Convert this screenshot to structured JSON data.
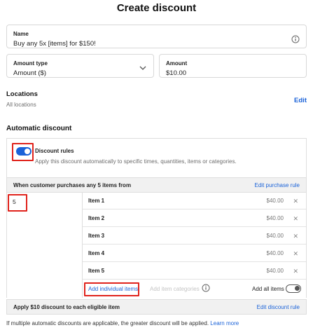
{
  "page": {
    "title": "Create discount"
  },
  "name_field": {
    "label": "Name",
    "value": "Buy any 5x [items] for $150!"
  },
  "amount_type_field": {
    "label": "Amount type",
    "value": "Amount ($)"
  },
  "amount_field": {
    "label": "Amount",
    "value": "$10.00"
  },
  "locations": {
    "title": "Locations",
    "subtitle": "All locations",
    "edit_label": "Edit"
  },
  "automatic_discount": {
    "title": "Automatic discount",
    "rules_title": "Discount rules",
    "rules_desc": "Apply this discount automatically to specific times, quantities, items or categories.",
    "rules_enabled": true
  },
  "purchase_rule": {
    "text": "When customer purchases any 5 items from",
    "edit_label": "Edit purchase rule",
    "quantity": "5"
  },
  "items": [
    {
      "name": "Item 1",
      "price": "$40.00"
    },
    {
      "name": "Item 2",
      "price": "$40.00"
    },
    {
      "name": "Item 3",
      "price": "$40.00"
    },
    {
      "name": "Item 4",
      "price": "$40.00"
    },
    {
      "name": "Item 5",
      "price": "$40.00"
    }
  ],
  "item_actions": {
    "add_individual": "Add individual items",
    "add_categories": "Add item categories",
    "add_all": "Add all items",
    "add_all_enabled": false
  },
  "discount_rule": {
    "text": "Apply $10 discount to each eligible item",
    "edit_label": "Edit discount rule"
  },
  "footnote": {
    "text": "If multiple automatic discounts are applicable, the greater discount will be applied.",
    "link": "Learn more"
  },
  "colors": {
    "accent": "#1a62d8",
    "highlight": "#e0231c"
  }
}
